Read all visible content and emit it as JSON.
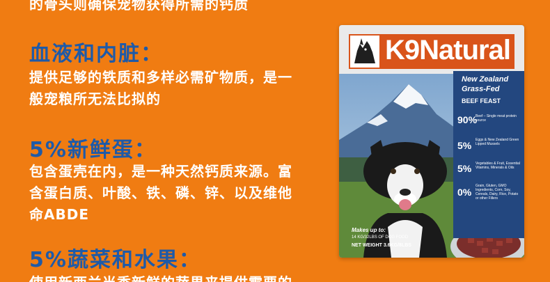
{
  "intro_line": "的骨头则确保宠物获得所需的钙质",
  "sections": [
    {
      "heading": "血液和内脏：",
      "lines": [
        "提供足够的铁质和多样必需矿物质，是一",
        "般宠粮所无法比拟的"
      ]
    },
    {
      "heading": "5%新鲜蛋：",
      "lines": [
        "包含蛋壳在内，是一种天然钙质来源。富",
        "含蛋白质、叶酸、铁、磷、锌、以及维他",
        "命ABDE"
      ]
    },
    {
      "heading": "5%蔬菜和水果：",
      "lines": [
        "使用新西兰当季新鲜的蔬果来提供需要的"
      ]
    }
  ],
  "package": {
    "brand": "K9Natural",
    "tagline_1": "New Zealand",
    "tagline_2": "Grass-Fed",
    "variant": "BEEF FEAST",
    "ingredients": [
      {
        "percent": "90%",
        "text": "Beef – Single meat protein source"
      },
      {
        "percent": "5%",
        "text": "Eggs & New Zealand Green Lipped Mussels"
      },
      {
        "percent": "5%",
        "text": "Vegetables & Fruit, Essential Vitamins, Minerals & Oils"
      },
      {
        "percent": "0%",
        "text": "Grain, Gluten, GMO Ingredients, Corn, Soy, Cereals, Dairy, Rice, Potato or other Fillers"
      }
    ],
    "makes_label": "Makes up to:",
    "makes_value": "14 KG/32LBS OF DOG FOOD",
    "net_weight": "NET WEIGHT 3.6KG/8LBS"
  },
  "colors": {
    "background": "#f07c12",
    "heading": "#1e5aa8",
    "body_text": "#ffffff",
    "brand_band": "#d9541a",
    "package_panel": "#23477f"
  }
}
